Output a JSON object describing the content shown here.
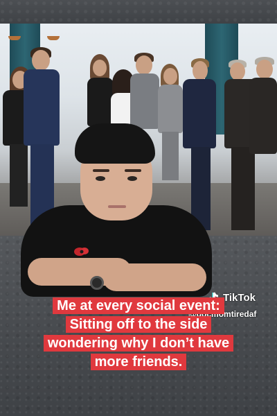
{
  "caption": {
    "lines": [
      "Me at every social event:",
      "Sitting off to the side",
      "wondering why I don’t have",
      "more friends."
    ]
  },
  "watermark": {
    "brand": "TikTok",
    "handle": "@docmomtiredaf",
    "logo_icon": "tiktok-note-icon"
  },
  "colors": {
    "caption_background": "#e0393e",
    "caption_text": "#ffffff"
  }
}
